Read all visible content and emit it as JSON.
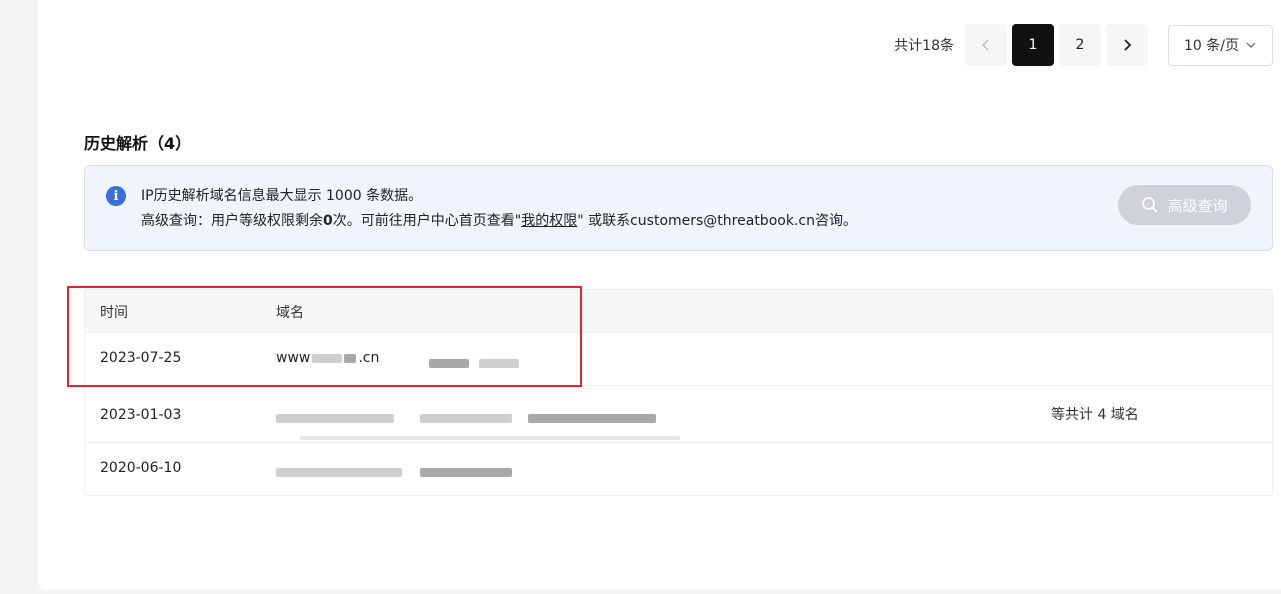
{
  "pagination": {
    "total_text": "共计18条",
    "pages": [
      "1",
      "2"
    ],
    "active_page": "1",
    "page_size": "10 条/页"
  },
  "section": {
    "title": "历史解析（4）"
  },
  "notice": {
    "line1": "IP历史解析域名信息最大显示 1000 条数据。",
    "line2_prefix": "高级查询：用户等级权限剩余",
    "line2_count": "0",
    "line2_mid": "次。可前往用户中心首页查看\"",
    "line2_link": "我的权限",
    "line2_suffix": "\" 或联系customers@threatbook.cn咨询。",
    "button_label": "高级查询"
  },
  "table": {
    "headers": {
      "time": "时间",
      "domain": "域名"
    },
    "rows": [
      {
        "time": "2023-07-25",
        "domain_prefix": "www",
        "domain_suffix": ".cn"
      },
      {
        "time": "2023-01-03",
        "extra": "等共计 4 域名"
      },
      {
        "time": "2020-06-10"
      }
    ]
  },
  "colors": {
    "highlight": "#e0252d",
    "active_page_bg": "#111111",
    "info_icon": "#3b6fd8"
  }
}
